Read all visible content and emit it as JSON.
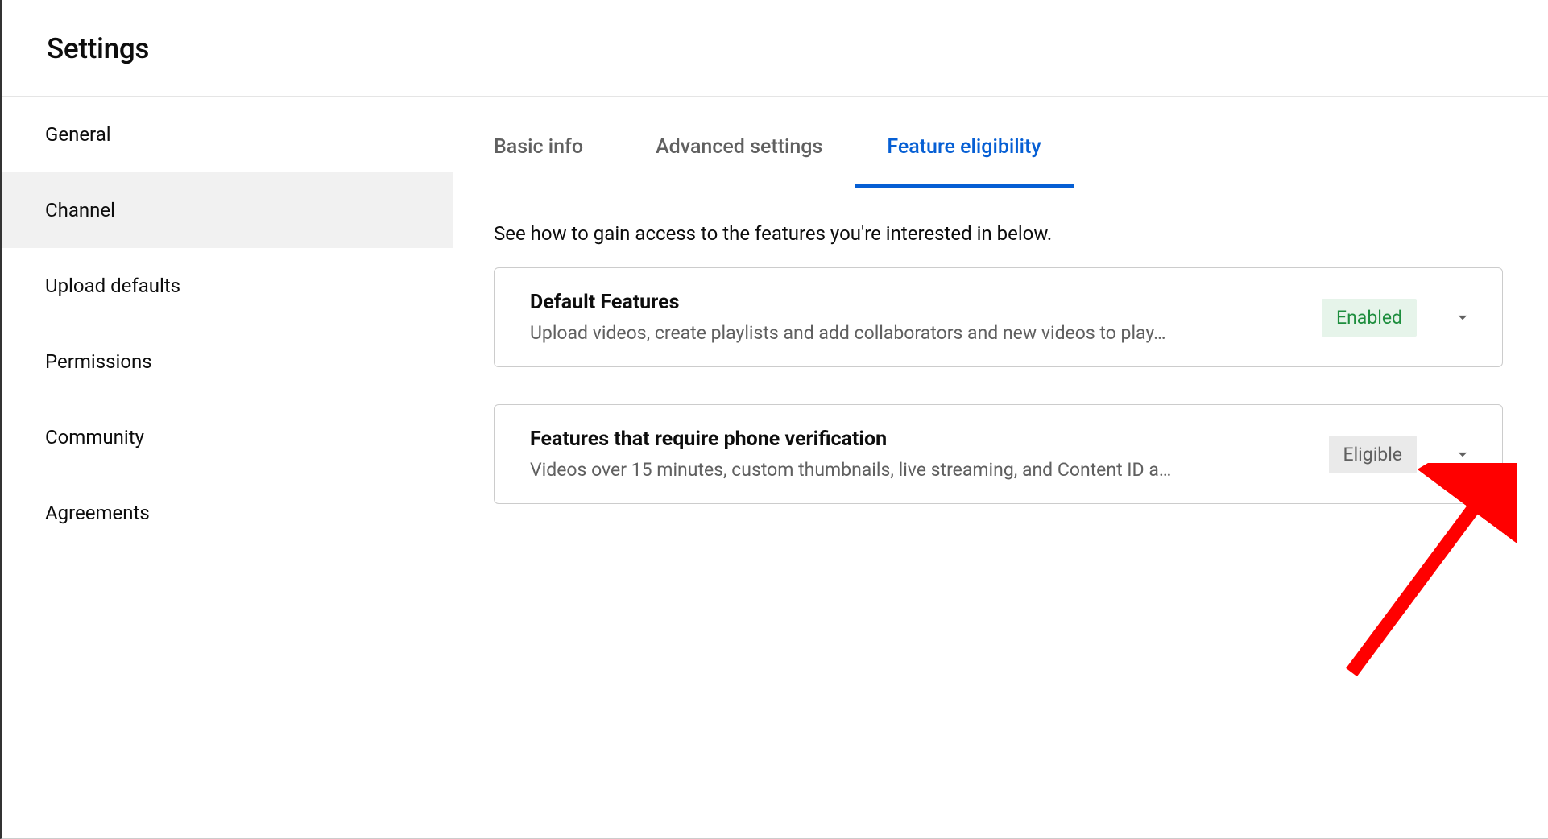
{
  "header": {
    "title": "Settings"
  },
  "sidebar": {
    "items": [
      {
        "label": "General",
        "active": false
      },
      {
        "label": "Channel",
        "active": true
      },
      {
        "label": "Upload defaults",
        "active": false
      },
      {
        "label": "Permissions",
        "active": false
      },
      {
        "label": "Community",
        "active": false
      },
      {
        "label": "Agreements",
        "active": false
      }
    ]
  },
  "tabs": [
    {
      "label": "Basic info",
      "active": false
    },
    {
      "label": "Advanced settings",
      "active": false
    },
    {
      "label": "Feature eligibility",
      "active": true
    }
  ],
  "content": {
    "intro": "See how to gain access to the features you're interested in below.",
    "cards": [
      {
        "title": "Default Features",
        "desc": "Upload videos, create playlists and add collaborators and new videos to play…",
        "badge": "Enabled",
        "badgeType": "enabled"
      },
      {
        "title": "Features that require phone verification",
        "desc": "Videos over 15 minutes, custom thumbnails, live streaming, and Content ID a…",
        "badge": "Eligible",
        "badgeType": "eligible"
      }
    ]
  }
}
